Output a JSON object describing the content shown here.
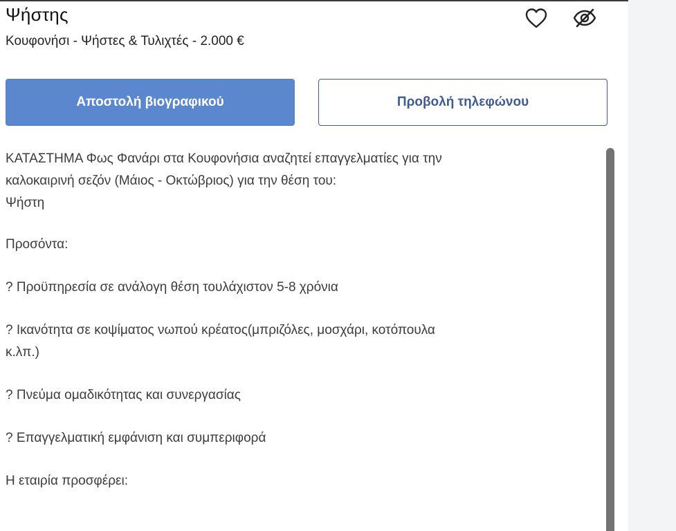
{
  "job": {
    "title": "Ψήστης",
    "subtitle": "Κουφονήσι - Ψήστες & Τυλιχτές - 2.000 €"
  },
  "icons": {
    "favorite": "heart-icon",
    "hide": "eye-off-icon"
  },
  "actions": {
    "apply_label": "Αποστολή βιογραφικού",
    "phone_label": "Προβολή τηλεφώνου"
  },
  "description": {
    "intro_line1": "ΚΑΤΑΣΤΗΜΑ Φως Φανάρι στα Κουφονήσια αναζητεί επαγγελματίες για την",
    "intro_line2": "καλοκαιρινή σεζόν (Μάιος - Οκτώβριος) για την θέση του:",
    "position": "Ψήστη",
    "qualifications_heading": "Προσόντα:",
    "qualification_1": "? Προϋπηρεσία σε ανάλογη θέση τουλάχιστον 5-8 χρόνια",
    "qualification_2_line1": "? Ικανότητα σε κοψίματος νωπού κρέατος(μπριζόλες, μοσχάρι, κοτόπουλα",
    "qualification_2_line2": "κ.λπ.)",
    "qualification_3": "? Πνεύμα ομαδικότητας και συνεργασίας",
    "qualification_4": "? Επαγγελματική εμφάνιση και συμπεριφορά",
    "offers_heading": "Η εταιρία προσφέρει:"
  },
  "colors": {
    "primary_button": "#5b87cf",
    "secondary_button_border": "#3f5c91",
    "scrollbar_thumb": "#737373"
  }
}
